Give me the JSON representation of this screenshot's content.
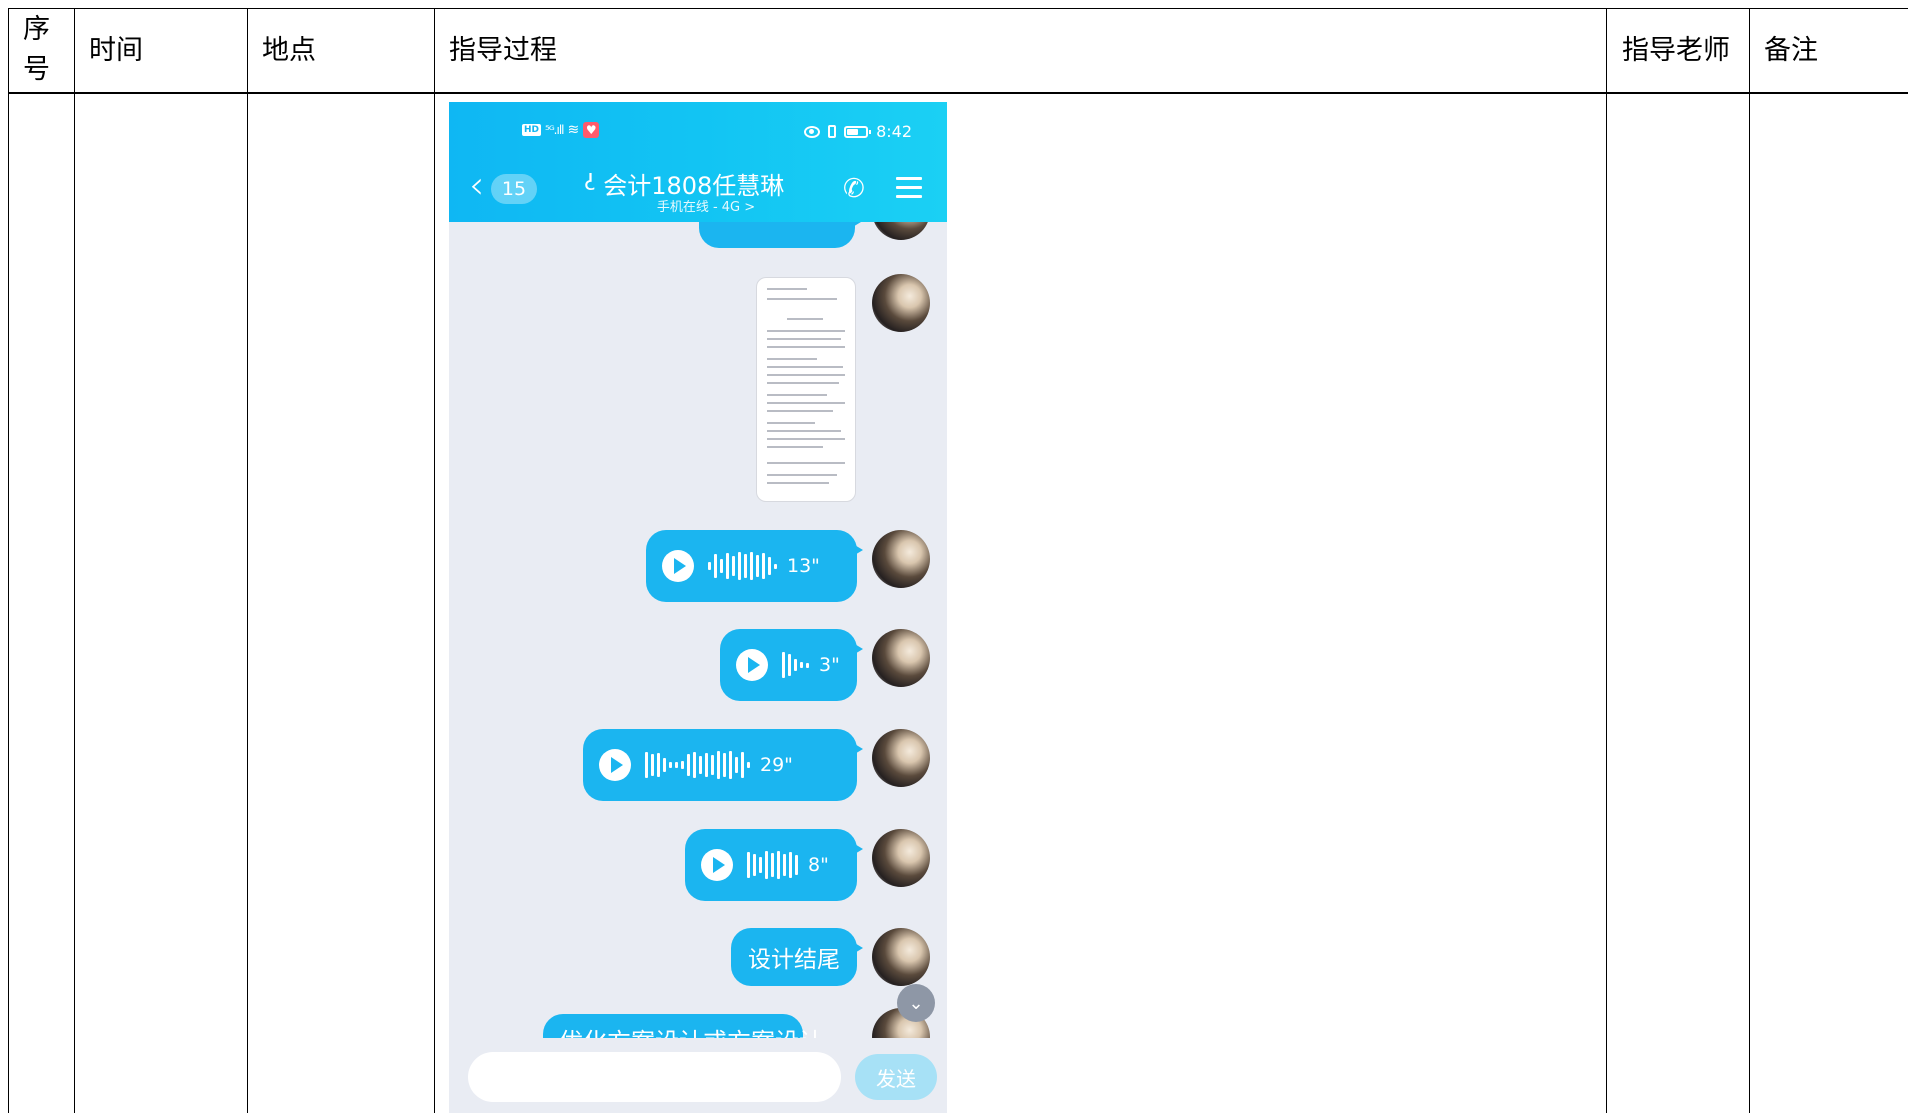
{
  "table": {
    "headers": {
      "seq_line1": "序",
      "seq_line2": "号",
      "time": "时间",
      "place": "地点",
      "process": "指导过程",
      "teacher": "指导老师",
      "remark": "备注"
    }
  },
  "phone": {
    "status_time": "8:42",
    "signal_label": "⁵ᴳ.ıll",
    "back_badge": "15",
    "chat_title": "会计1808任慧琳",
    "chat_subtitle": "手机在线 - 4G >",
    "messages": [
      {
        "type": "voice",
        "duration": "13\""
      },
      {
        "type": "voice",
        "duration": "3\""
      },
      {
        "type": "voice",
        "duration": "29\""
      },
      {
        "type": "voice",
        "duration": "8\""
      },
      {
        "type": "text",
        "text": "设计结尾"
      }
    ],
    "cut_off_text": "优化方案设计或方案设计",
    "send_label": "发送",
    "input_value": ""
  },
  "colors": {
    "header_blue": "#12c4f3",
    "bubble_blue": "#1bb5f0",
    "chat_background": "#e9ecf3"
  }
}
